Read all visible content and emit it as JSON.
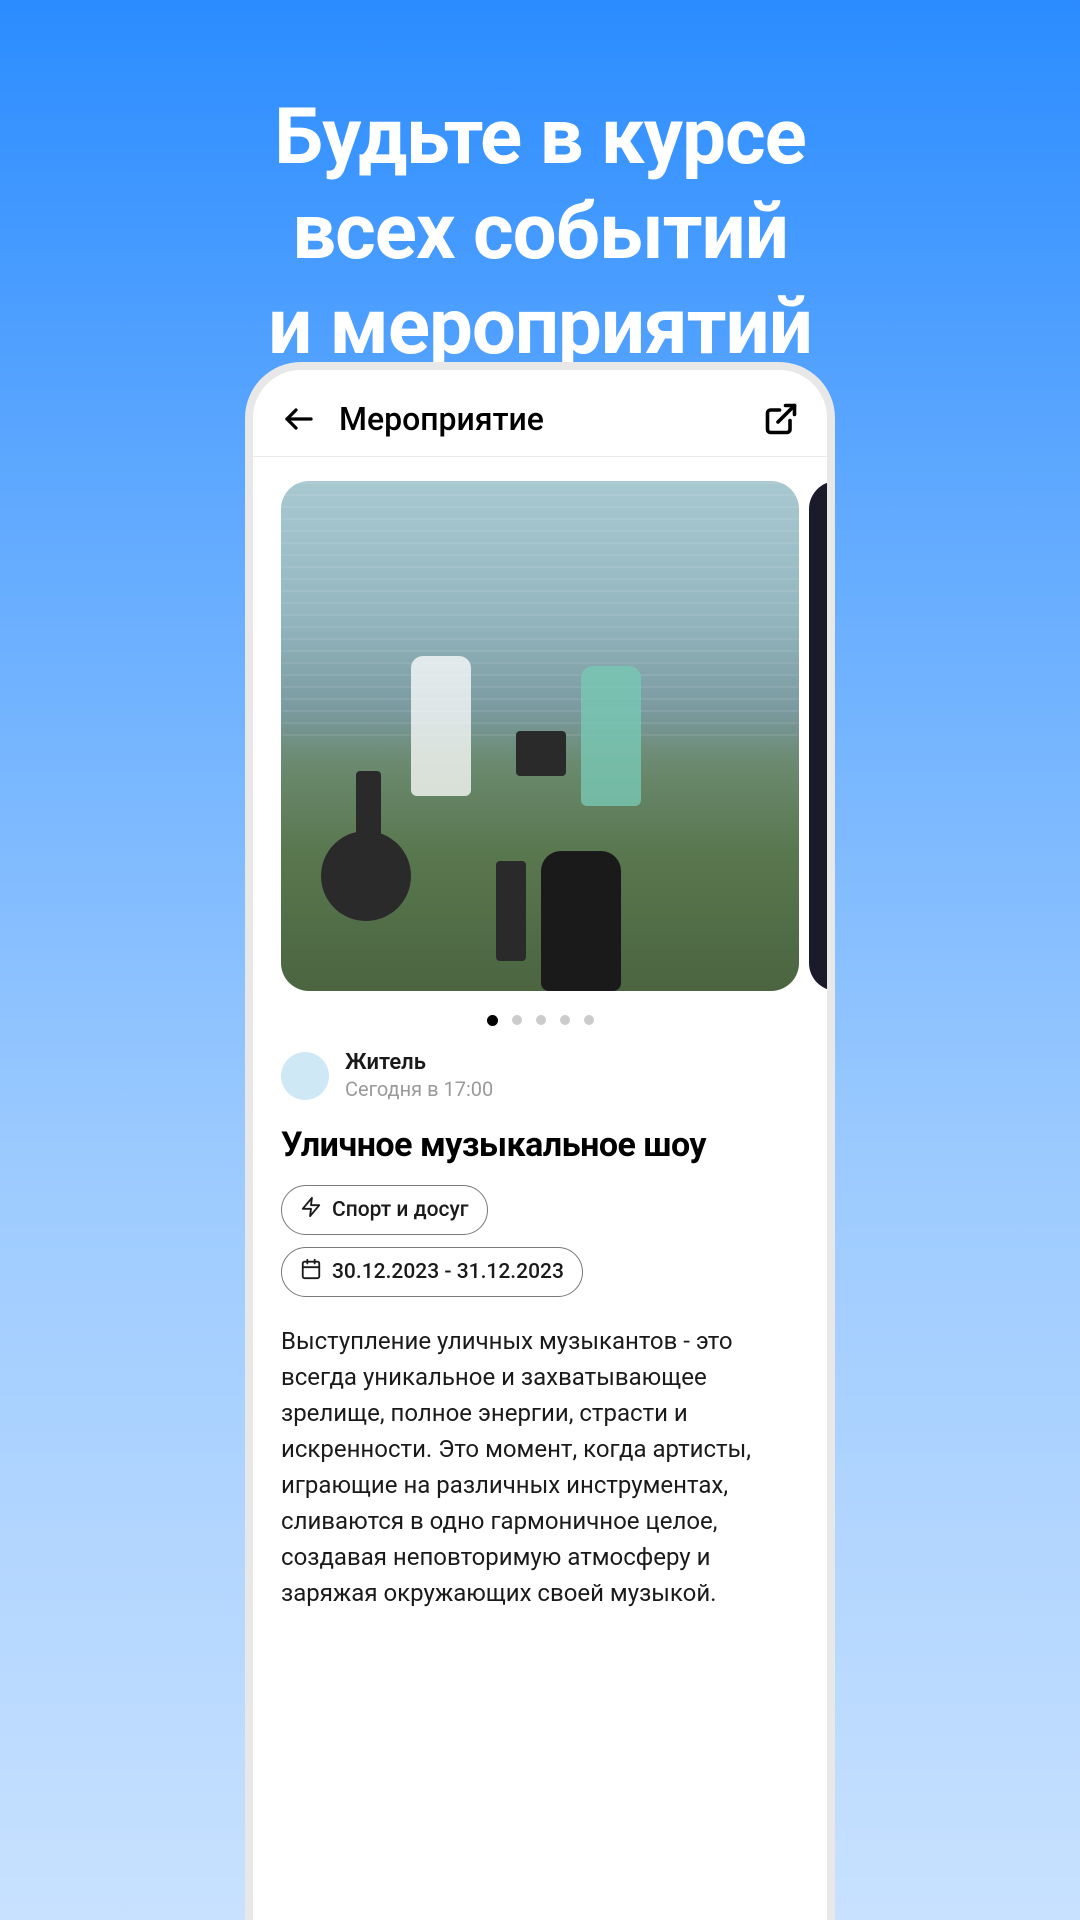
{
  "promo": {
    "title_line1": "Будьте в курсе",
    "title_line2": "всех событий",
    "title_line3": "и мероприятий"
  },
  "header": {
    "title": "Мероприятие"
  },
  "carousel": {
    "total_dots": 5,
    "active_index": 0
  },
  "author": {
    "name": "Житель",
    "time": "Сегодня в 17:00"
  },
  "event": {
    "title": "Уличное музыкальное шоу",
    "category": "Спорт и досуг",
    "date_range": "30.12.2023 - 31.12.2023",
    "description": "Выступление уличных музыкантов - это всегда уникальное и захватывающее зрелище, полное энергии, страсти и искренности. Это момент, когда артисты, играющие на различных инструментах, сливаются в одно гармоничное целое, создавая неповторимую атмосферу и заряжая окружающих своей музыкой."
  }
}
